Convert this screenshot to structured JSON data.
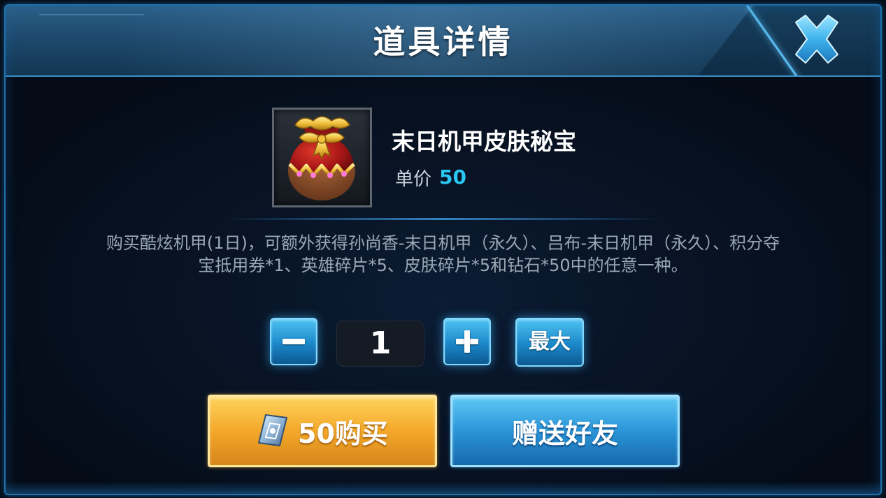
{
  "dialog": {
    "title": "道具详情",
    "close_icon": "close-x-icon"
  },
  "item": {
    "icon": "lucky-bag-icon",
    "name": "末日机甲皮肤秘宝",
    "price_label": "单价",
    "price_value": "50",
    "description": "购买酷炫机甲(1日)，可额外获得孙尚香-末日机甲（永久）、吕布-末日机甲（永久）、积分夺宝抵用券*1、英雄碎片*5、皮肤碎片*5和钻石*50中的任意一种。"
  },
  "quantity": {
    "minus_icon": "minus-icon",
    "plus_icon": "plus-icon",
    "value": "1",
    "max_label": "最大"
  },
  "actions": {
    "buy_icon": "voucher-coupon-icon",
    "buy_label": "50购买",
    "gift_label": "赠送好友"
  },
  "colors": {
    "accent_blue": "#29c7f3",
    "buy_gold": "#f3a82a",
    "gift_blue": "#2a95d8",
    "title_white": "#ffffff"
  }
}
